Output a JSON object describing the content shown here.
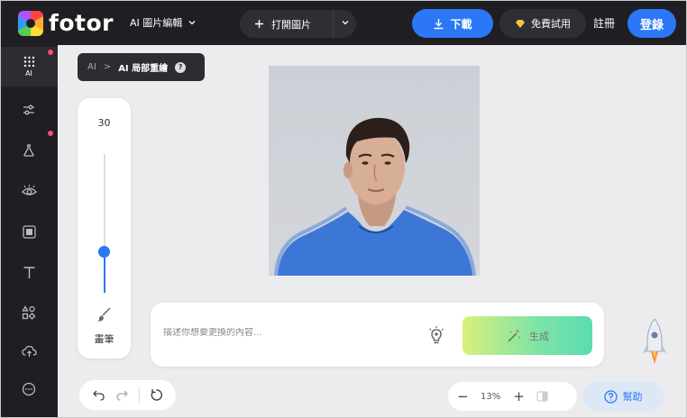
{
  "header": {
    "logo_text": "fotor",
    "app_menu_label": "AI 圖片編輯",
    "open_image_label": "打開圖片",
    "download_label": "下載",
    "free_trial_label": "免費試用",
    "register_label": "註冊",
    "login_label": "登錄"
  },
  "sidebar": {
    "items": [
      {
        "icon": "ai-grid-icon",
        "label": "AI",
        "active": true
      },
      {
        "icon": "sliders-icon"
      },
      {
        "icon": "flask-icon"
      },
      {
        "icon": "eye-icon"
      },
      {
        "icon": "frame-icon"
      },
      {
        "icon": "text-icon"
      },
      {
        "icon": "elements-icon"
      },
      {
        "icon": "upload-cloud-icon"
      },
      {
        "icon": "more-icon"
      }
    ]
  },
  "breadcrumb": {
    "root": "AI",
    "separator": ">",
    "current": "AI 局部重繪",
    "help": "?"
  },
  "brush": {
    "size": "30",
    "label": "畫筆",
    "level_fraction": 0.3
  },
  "prompt": {
    "placeholder": "描述你想要更換的內容...",
    "generate_label": "生成"
  },
  "zoom": {
    "minus": "−",
    "level": "13%",
    "plus": "+"
  },
  "help_label": "幫助",
  "colors": {
    "accent": "#2b77f6",
    "topbar": "#1f1f23",
    "canvas_bg": "#ececee",
    "mask_overlay": "#2f6fd6"
  }
}
